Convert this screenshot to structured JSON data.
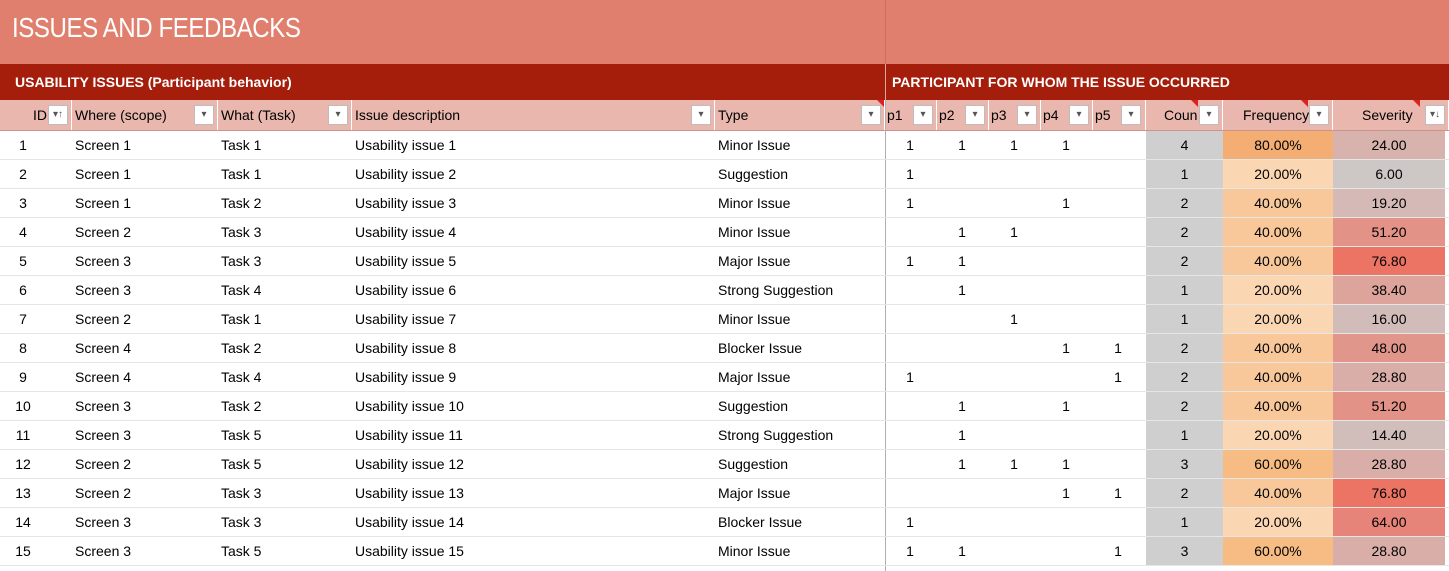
{
  "title": "ISSUES AND FEEDBACKS",
  "section_left": "USABILITY ISSUES (Participant behavior)",
  "section_right": "PARTICIPANT FOR WHOM THE ISSUE OCCURRED",
  "headers": {
    "id": "ID",
    "where": "Where (scope)",
    "what": "What (Task)",
    "desc": "Issue description",
    "type": "Type",
    "p1": "p1",
    "p2": "p2",
    "p3": "p3",
    "p4": "p4",
    "p5": "p5",
    "count": "Coun",
    "frequency": "Frequency",
    "severity": "Severity"
  },
  "filter_icons": {
    "sort_asc": "sort-ascending-filter-icon",
    "dropdown": "dropdown-filter-icon",
    "sort_desc": "sort-descending-filter-icon"
  },
  "colors": {
    "title_band": "#e07f6d",
    "section_band": "#a51d0b",
    "header_row": "#e9b7ae",
    "count_bg": "#cfcfcf",
    "freq_20": "#fbd6b2",
    "freq_40": "#f8c89b",
    "freq_60": "#f6bc84",
    "freq_80": "#f4ad72",
    "comment_marker": "#e02020"
  },
  "rows": [
    {
      "id": "1",
      "where": "Screen 1",
      "what": "Task 1",
      "desc": "Usability issue 1",
      "type": "Minor Issue",
      "p1": "1",
      "p2": "1",
      "p3": "1",
      "p4": "1",
      "p5": "",
      "count": "4",
      "frequency": "80.00%",
      "severity": "24.00",
      "freq_color": "#f4ad72",
      "sev_color": "#d8b2ad"
    },
    {
      "id": "2",
      "where": "Screen 1",
      "what": "Task 1",
      "desc": "Usability issue 2",
      "type": "Suggestion",
      "p1": "1",
      "p2": "",
      "p3": "",
      "p4": "",
      "p5": "",
      "count": "1",
      "frequency": "20.00%",
      "severity": "6.00",
      "freq_color": "#fbd6b2",
      "sev_color": "#cdc7c6"
    },
    {
      "id": "3",
      "where": "Screen 1",
      "what": "Task 2",
      "desc": "Usability issue 3",
      "type": "Minor Issue",
      "p1": "1",
      "p2": "",
      "p3": "",
      "p4": "1",
      "p5": "",
      "count": "2",
      "frequency": "40.00%",
      "severity": "19.20",
      "freq_color": "#f8c89b",
      "sev_color": "#d4b9b6"
    },
    {
      "id": "4",
      "where": "Screen 2",
      "what": "Task 3",
      "desc": "Usability issue 4",
      "type": "Minor Issue",
      "p1": "",
      "p2": "1",
      "p3": "1",
      "p4": "",
      "p5": "",
      "count": "2",
      "frequency": "40.00%",
      "severity": "51.20",
      "freq_color": "#f8c89b",
      "sev_color": "#e39287"
    },
    {
      "id": "5",
      "where": "Screen 3",
      "what": "Task 3",
      "desc": "Usability issue 5",
      "type": "Major Issue",
      "p1": "1",
      "p2": "1",
      "p3": "",
      "p4": "",
      "p5": "",
      "count": "2",
      "frequency": "40.00%",
      "severity": "76.80",
      "freq_color": "#f8c89b",
      "sev_color": "#ec7465"
    },
    {
      "id": "6",
      "where": "Screen 3",
      "what": "Task 4",
      "desc": "Usability issue 6",
      "type": "Strong Suggestion",
      "p1": "",
      "p2": "1",
      "p3": "",
      "p4": "",
      "p5": "",
      "count": "1",
      "frequency": "20.00%",
      "severity": "38.40",
      "freq_color": "#fbd6b2",
      "sev_color": "#dda49c"
    },
    {
      "id": "7",
      "where": "Screen 2",
      "what": "Task 1",
      "desc": "Usability issue 7",
      "type": "Minor Issue",
      "p1": "",
      "p2": "",
      "p3": "1",
      "p4": "",
      "p5": "",
      "count": "1",
      "frequency": "20.00%",
      "severity": "16.00",
      "freq_color": "#fbd6b2",
      "sev_color": "#d2bcb9"
    },
    {
      "id": "8",
      "where": "Screen 4",
      "what": "Task 2",
      "desc": "Usability issue 8",
      "type": "Blocker Issue",
      "p1": "",
      "p2": "",
      "p3": "",
      "p4": "1",
      "p5": "1",
      "count": "2",
      "frequency": "40.00%",
      "severity": "48.00",
      "freq_color": "#f8c89b",
      "sev_color": "#e1968c"
    },
    {
      "id": "9",
      "where": "Screen 4",
      "what": "Task 4",
      "desc": "Usability issue 9",
      "type": "Major Issue",
      "p1": "1",
      "p2": "",
      "p3": "",
      "p4": "",
      "p5": "1",
      "count": "2",
      "frequency": "40.00%",
      "severity": "28.80",
      "freq_color": "#f8c89b",
      "sev_color": "#d9aea8"
    },
    {
      "id": "10",
      "where": "Screen 3",
      "what": "Task 2",
      "desc": "Usability issue 10",
      "type": "Suggestion",
      "p1": "",
      "p2": "1",
      "p3": "",
      "p4": "1",
      "p5": "",
      "count": "2",
      "frequency": "40.00%",
      "severity": "51.20",
      "freq_color": "#f8c89b",
      "sev_color": "#e39287"
    },
    {
      "id": "11",
      "where": "Screen 3",
      "what": "Task 5",
      "desc": "Usability issue 11",
      "type": "Strong Suggestion",
      "p1": "",
      "p2": "1",
      "p3": "",
      "p4": "",
      "p5": "",
      "count": "1",
      "frequency": "20.00%",
      "severity": "14.40",
      "freq_color": "#fbd6b2",
      "sev_color": "#d1beba"
    },
    {
      "id": "12",
      "where": "Screen 2",
      "what": "Task 5",
      "desc": "Usability issue 12",
      "type": "Suggestion",
      "p1": "",
      "p2": "1",
      "p3": "1",
      "p4": "1",
      "p5": "",
      "count": "3",
      "frequency": "60.00%",
      "severity": "28.80",
      "freq_color": "#f6bc84",
      "sev_color": "#d9aea8"
    },
    {
      "id": "13",
      "where": "Screen 2",
      "what": "Task 3",
      "desc": "Usability issue 13",
      "type": "Major Issue",
      "p1": "",
      "p2": "",
      "p3": "",
      "p4": "1",
      "p5": "1",
      "count": "2",
      "frequency": "40.00%",
      "severity": "76.80",
      "freq_color": "#f8c89b",
      "sev_color": "#ec7465"
    },
    {
      "id": "14",
      "where": "Screen 3",
      "what": "Task 3",
      "desc": "Usability issue 14",
      "type": "Blocker Issue",
      "p1": "1",
      "p2": "",
      "p3": "",
      "p4": "",
      "p5": "",
      "count": "1",
      "frequency": "20.00%",
      "severity": "64.00",
      "freq_color": "#fbd6b2",
      "sev_color": "#e7847a"
    },
    {
      "id": "15",
      "where": "Screen 3",
      "what": "Task 5",
      "desc": "Usability issue 15",
      "type": "Minor Issue",
      "p1": "1",
      "p2": "1",
      "p3": "",
      "p4": "",
      "p5": "1",
      "count": "3",
      "frequency": "60.00%",
      "severity": "28.80",
      "freq_color": "#f6bc84",
      "sev_color": "#d9aea8"
    }
  ]
}
